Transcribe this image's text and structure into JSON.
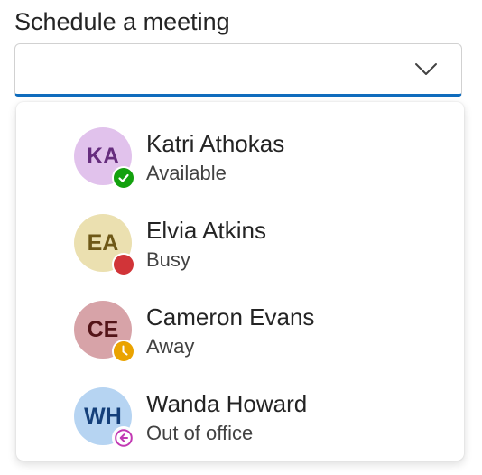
{
  "label": "Schedule a meeting",
  "combobox": {
    "value": "",
    "placeholder": "",
    "chevron_icon": "chevron-down-icon"
  },
  "options": [
    {
      "initials": "KA",
      "name": "Katri Athokas",
      "status": "Available",
      "avatar_bg": "#e1c2ec",
      "avatar_fg": "#662d7e",
      "presence": "available",
      "presence_icon": "checkmark-icon",
      "presence_color": "#13a10e"
    },
    {
      "initials": "EA",
      "name": "Elvia Atkins",
      "status": "Busy",
      "avatar_bg": "#ebe0b0",
      "avatar_fg": "#6e5817",
      "presence": "busy",
      "presence_icon": "busy-dot-icon",
      "presence_color": "#d13438"
    },
    {
      "initials": "CE",
      "name": "Cameron Evans",
      "status": "Away",
      "avatar_bg": "#d7a3a8",
      "avatar_fg": "#531418",
      "presence": "away",
      "presence_icon": "clock-icon",
      "presence_color": "#eaa300"
    },
    {
      "initials": "WH",
      "name": "Wanda Howard",
      "status": "Out of office",
      "avatar_bg": "#b6d4f2",
      "avatar_fg": "#143f7a",
      "presence": "out-of-office",
      "presence_icon": "arrow-left-circle-icon",
      "presence_color": "#c239b3"
    }
  ],
  "colors": {
    "focus_underline": "#0f6cbd",
    "text_primary": "#242424",
    "text_secondary": "#424242"
  }
}
